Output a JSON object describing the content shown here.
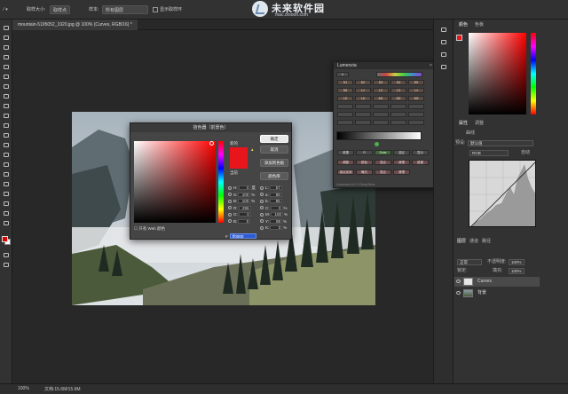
{
  "options_bar": {
    "sample_size_label": "取样大小:",
    "sample_size_value": "取样点",
    "sample_label": "样本:",
    "sample_value": "所有图层",
    "show_ring_label": "显示取样环"
  },
  "watermark": {
    "title": "未来软件园",
    "url": "mac.orsoon.com"
  },
  "document": {
    "tab_title": "mountain-5195052_1920.jpg @ 100% (Curves, RGB/16) *"
  },
  "color_picker": {
    "title": "拾色器（前景色）",
    "ok": "确定",
    "cancel": "取消",
    "add_swatch": "添加到色板",
    "libraries": "颜色库",
    "new_label": "新的",
    "current_label": "当前",
    "web_only": "只有 Web 颜色",
    "fields": [
      {
        "label": "H:",
        "value": "0",
        "unit": "度",
        "label2": "L:",
        "value2": "57"
      },
      {
        "label": "S:",
        "value": "100",
        "unit": "%",
        "label2": "a:",
        "value2": "95"
      },
      {
        "label": "B:",
        "value": "100",
        "unit": "%",
        "label2": "b:",
        "value2": "85"
      },
      {
        "label": "R:",
        "value": "255",
        "unit": "",
        "label2": "C:",
        "value2": "0",
        "unit2": "%"
      },
      {
        "label": "G:",
        "value": "0",
        "unit": "",
        "label2": "M:",
        "value2": "100",
        "unit2": "%"
      },
      {
        "label": "B:",
        "value": "0",
        "unit": "",
        "label2": "Y:",
        "value2": "98",
        "unit2": "%"
      },
      {
        "label": "",
        "value": "",
        "unit": "",
        "label2": "K:",
        "value2": "0",
        "unit2": "%"
      }
    ],
    "hex_prefix": "#",
    "hex": "ff0000"
  },
  "lumenzia": {
    "title": "Lumenzia",
    "zone_buttons": [
      "D1",
      "D2",
      "D3",
      "D4",
      "D5",
      "D6",
      "L1",
      "L2",
      "L3",
      "L4",
      "L5",
      "L6",
      "M1",
      "M2",
      "M3"
    ],
    "action_row1": [
      "遮罩",
      "R",
      "Zone",
      "选区",
      "显示"
    ],
    "action_row2": [
      "调整",
      "颜色",
      "混合",
      "清理",
      "遮罩"
    ],
    "action_row3": [
      "减淡加深",
      "曝光",
      "混合",
      "清理"
    ],
    "version": "Lumenzia v9.1.0 Greg Benz"
  },
  "right_panels": {
    "color_tabs": [
      "颜色",
      "色板"
    ],
    "props_tabs": [
      "属性",
      "调整"
    ],
    "curves_label": "曲线",
    "preset_label": "预设:",
    "preset_value": "默认值",
    "channel_value": "RGB",
    "auto_label": "自动",
    "layers_tabs": [
      "图层",
      "通道",
      "路径"
    ],
    "blend_mode": "正常",
    "opacity_label": "不透明度:",
    "opacity_value": "100%",
    "lock_label": "锁定:",
    "fill_label": "填充:",
    "fill_value": "100%",
    "layers": [
      {
        "name": "Curves",
        "selected": true
      },
      {
        "name": "背景",
        "selected": false
      }
    ]
  },
  "status": {
    "zoom": "100%",
    "doc_info": "文档:15.6M/15.6M"
  }
}
